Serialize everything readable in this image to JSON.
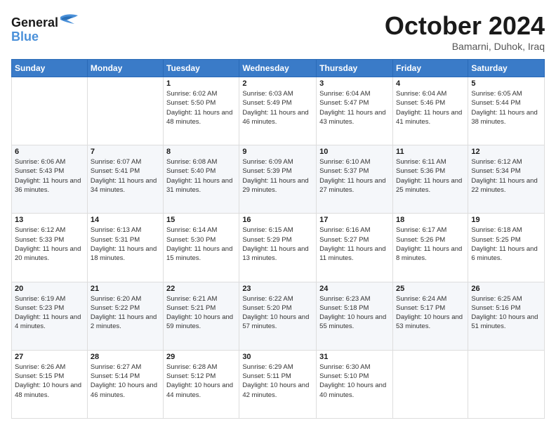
{
  "header": {
    "logo_general": "General",
    "logo_blue": "Blue",
    "month_title": "October 2024",
    "location": "Bamarni, Duhok, Iraq"
  },
  "weekdays": [
    "Sunday",
    "Monday",
    "Tuesday",
    "Wednesday",
    "Thursday",
    "Friday",
    "Saturday"
  ],
  "weeks": [
    [
      {
        "day": "",
        "sunrise": "",
        "sunset": "",
        "daylight": ""
      },
      {
        "day": "",
        "sunrise": "",
        "sunset": "",
        "daylight": ""
      },
      {
        "day": "1",
        "sunrise": "Sunrise: 6:02 AM",
        "sunset": "Sunset: 5:50 PM",
        "daylight": "Daylight: 11 hours and 48 minutes."
      },
      {
        "day": "2",
        "sunrise": "Sunrise: 6:03 AM",
        "sunset": "Sunset: 5:49 PM",
        "daylight": "Daylight: 11 hours and 46 minutes."
      },
      {
        "day": "3",
        "sunrise": "Sunrise: 6:04 AM",
        "sunset": "Sunset: 5:47 PM",
        "daylight": "Daylight: 11 hours and 43 minutes."
      },
      {
        "day": "4",
        "sunrise": "Sunrise: 6:04 AM",
        "sunset": "Sunset: 5:46 PM",
        "daylight": "Daylight: 11 hours and 41 minutes."
      },
      {
        "day": "5",
        "sunrise": "Sunrise: 6:05 AM",
        "sunset": "Sunset: 5:44 PM",
        "daylight": "Daylight: 11 hours and 38 minutes."
      }
    ],
    [
      {
        "day": "6",
        "sunrise": "Sunrise: 6:06 AM",
        "sunset": "Sunset: 5:43 PM",
        "daylight": "Daylight: 11 hours and 36 minutes."
      },
      {
        "day": "7",
        "sunrise": "Sunrise: 6:07 AM",
        "sunset": "Sunset: 5:41 PM",
        "daylight": "Daylight: 11 hours and 34 minutes."
      },
      {
        "day": "8",
        "sunrise": "Sunrise: 6:08 AM",
        "sunset": "Sunset: 5:40 PM",
        "daylight": "Daylight: 11 hours and 31 minutes."
      },
      {
        "day": "9",
        "sunrise": "Sunrise: 6:09 AM",
        "sunset": "Sunset: 5:39 PM",
        "daylight": "Daylight: 11 hours and 29 minutes."
      },
      {
        "day": "10",
        "sunrise": "Sunrise: 6:10 AM",
        "sunset": "Sunset: 5:37 PM",
        "daylight": "Daylight: 11 hours and 27 minutes."
      },
      {
        "day": "11",
        "sunrise": "Sunrise: 6:11 AM",
        "sunset": "Sunset: 5:36 PM",
        "daylight": "Daylight: 11 hours and 25 minutes."
      },
      {
        "day": "12",
        "sunrise": "Sunrise: 6:12 AM",
        "sunset": "Sunset: 5:34 PM",
        "daylight": "Daylight: 11 hours and 22 minutes."
      }
    ],
    [
      {
        "day": "13",
        "sunrise": "Sunrise: 6:12 AM",
        "sunset": "Sunset: 5:33 PM",
        "daylight": "Daylight: 11 hours and 20 minutes."
      },
      {
        "day": "14",
        "sunrise": "Sunrise: 6:13 AM",
        "sunset": "Sunset: 5:31 PM",
        "daylight": "Daylight: 11 hours and 18 minutes."
      },
      {
        "day": "15",
        "sunrise": "Sunrise: 6:14 AM",
        "sunset": "Sunset: 5:30 PM",
        "daylight": "Daylight: 11 hours and 15 minutes."
      },
      {
        "day": "16",
        "sunrise": "Sunrise: 6:15 AM",
        "sunset": "Sunset: 5:29 PM",
        "daylight": "Daylight: 11 hours and 13 minutes."
      },
      {
        "day": "17",
        "sunrise": "Sunrise: 6:16 AM",
        "sunset": "Sunset: 5:27 PM",
        "daylight": "Daylight: 11 hours and 11 minutes."
      },
      {
        "day": "18",
        "sunrise": "Sunrise: 6:17 AM",
        "sunset": "Sunset: 5:26 PM",
        "daylight": "Daylight: 11 hours and 8 minutes."
      },
      {
        "day": "19",
        "sunrise": "Sunrise: 6:18 AM",
        "sunset": "Sunset: 5:25 PM",
        "daylight": "Daylight: 11 hours and 6 minutes."
      }
    ],
    [
      {
        "day": "20",
        "sunrise": "Sunrise: 6:19 AM",
        "sunset": "Sunset: 5:23 PM",
        "daylight": "Daylight: 11 hours and 4 minutes."
      },
      {
        "day": "21",
        "sunrise": "Sunrise: 6:20 AM",
        "sunset": "Sunset: 5:22 PM",
        "daylight": "Daylight: 11 hours and 2 minutes."
      },
      {
        "day": "22",
        "sunrise": "Sunrise: 6:21 AM",
        "sunset": "Sunset: 5:21 PM",
        "daylight": "Daylight: 10 hours and 59 minutes."
      },
      {
        "day": "23",
        "sunrise": "Sunrise: 6:22 AM",
        "sunset": "Sunset: 5:20 PM",
        "daylight": "Daylight: 10 hours and 57 minutes."
      },
      {
        "day": "24",
        "sunrise": "Sunrise: 6:23 AM",
        "sunset": "Sunset: 5:18 PM",
        "daylight": "Daylight: 10 hours and 55 minutes."
      },
      {
        "day": "25",
        "sunrise": "Sunrise: 6:24 AM",
        "sunset": "Sunset: 5:17 PM",
        "daylight": "Daylight: 10 hours and 53 minutes."
      },
      {
        "day": "26",
        "sunrise": "Sunrise: 6:25 AM",
        "sunset": "Sunset: 5:16 PM",
        "daylight": "Daylight: 10 hours and 51 minutes."
      }
    ],
    [
      {
        "day": "27",
        "sunrise": "Sunrise: 6:26 AM",
        "sunset": "Sunset: 5:15 PM",
        "daylight": "Daylight: 10 hours and 48 minutes."
      },
      {
        "day": "28",
        "sunrise": "Sunrise: 6:27 AM",
        "sunset": "Sunset: 5:14 PM",
        "daylight": "Daylight: 10 hours and 46 minutes."
      },
      {
        "day": "29",
        "sunrise": "Sunrise: 6:28 AM",
        "sunset": "Sunset: 5:12 PM",
        "daylight": "Daylight: 10 hours and 44 minutes."
      },
      {
        "day": "30",
        "sunrise": "Sunrise: 6:29 AM",
        "sunset": "Sunset: 5:11 PM",
        "daylight": "Daylight: 10 hours and 42 minutes."
      },
      {
        "day": "31",
        "sunrise": "Sunrise: 6:30 AM",
        "sunset": "Sunset: 5:10 PM",
        "daylight": "Daylight: 10 hours and 40 minutes."
      },
      {
        "day": "",
        "sunrise": "",
        "sunset": "",
        "daylight": ""
      },
      {
        "day": "",
        "sunrise": "",
        "sunset": "",
        "daylight": ""
      }
    ]
  ]
}
